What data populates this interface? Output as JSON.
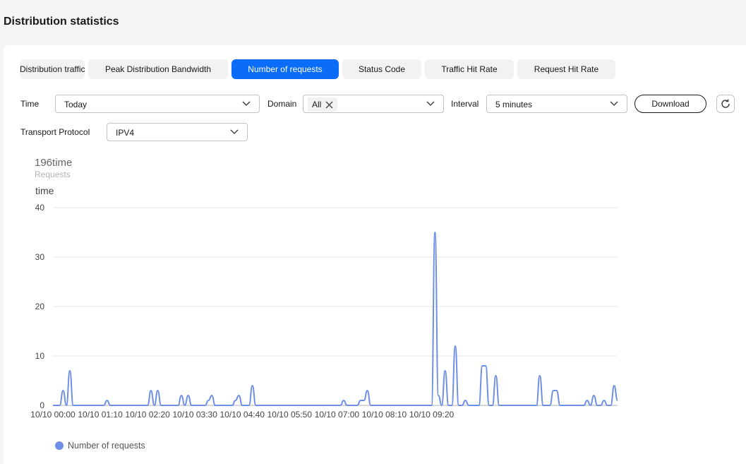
{
  "page_title": "Distribution statistics",
  "tabs": [
    {
      "label": "Distribution traffic",
      "active": false
    },
    {
      "label": "Peak Distribution Bandwidth",
      "active": false
    },
    {
      "label": "Number of requests",
      "active": true
    },
    {
      "label": "Status Code",
      "active": false
    },
    {
      "label": "Traffic Hit Rate",
      "active": false
    },
    {
      "label": "Request Hit Rate",
      "active": false
    }
  ],
  "filters": {
    "time_label": "Time",
    "time_value": "Today",
    "domain_label": "Domain",
    "domain_chip": "All",
    "interval_label": "Interval",
    "interval_value": "5 minutes",
    "protocol_label": "Transport Protocol",
    "protocol_value": "IPV4",
    "download_label": "Download"
  },
  "summary": {
    "value": "196time",
    "label": "Requests"
  },
  "icons": [
    "chevron-down-icon",
    "close-icon",
    "refresh-icon"
  ],
  "colors": {
    "accent": "#0a6cf7",
    "series": "#6f8fe6"
  },
  "chart_data": {
    "type": "line",
    "ylabel": "time",
    "ylim": [
      0,
      40
    ],
    "yticks": [
      0,
      10,
      20,
      30,
      40
    ],
    "xticks": [
      "10/10 00:00",
      "10/10 01:10",
      "10/10 02:20",
      "10/10 03:30",
      "10/10 04:40",
      "10/10 05:50",
      "10/10 07:00",
      "10/10 08:10",
      "10/10 09:20"
    ],
    "x_interval_minutes": 5,
    "grid": true,
    "legend": "bottom-left",
    "series": [
      {
        "name": "Number of requests",
        "values": [
          0,
          0,
          0,
          3,
          0,
          7,
          0,
          0,
          0,
          0,
          0,
          0,
          0,
          0,
          0,
          0,
          1,
          0,
          0,
          0,
          0,
          0,
          0,
          0,
          0,
          0,
          0,
          0,
          0,
          3,
          0,
          3,
          0,
          0,
          0,
          0,
          0,
          0,
          2,
          0,
          2,
          0,
          0,
          0,
          0,
          0,
          1,
          2,
          0,
          0,
          0,
          0,
          0,
          0,
          1,
          2,
          0,
          0,
          0,
          4,
          0,
          0,
          0,
          0,
          0,
          0,
          0,
          0,
          0,
          0,
          0,
          0,
          0,
          0,
          0,
          0,
          0,
          0,
          0,
          0,
          0,
          0,
          0,
          0,
          0,
          0,
          1,
          0,
          0,
          0,
          0,
          1,
          1,
          3,
          0,
          0,
          0,
          0,
          0,
          0,
          0,
          0,
          0,
          0,
          0,
          0,
          0,
          0,
          0,
          0,
          0,
          0,
          0,
          35,
          2,
          0,
          7,
          0,
          0,
          12,
          0,
          0,
          1,
          0,
          0,
          0,
          0,
          8,
          8,
          0,
          0,
          6,
          0,
          0,
          0,
          0,
          0,
          0,
          0,
          0,
          0,
          0,
          0,
          0,
          6,
          0,
          0,
          0,
          3,
          3,
          0,
          0,
          0,
          0,
          0,
          0,
          0,
          0,
          1,
          0,
          2,
          0,
          0,
          1,
          0,
          0,
          4,
          1
        ]
      }
    ]
  }
}
